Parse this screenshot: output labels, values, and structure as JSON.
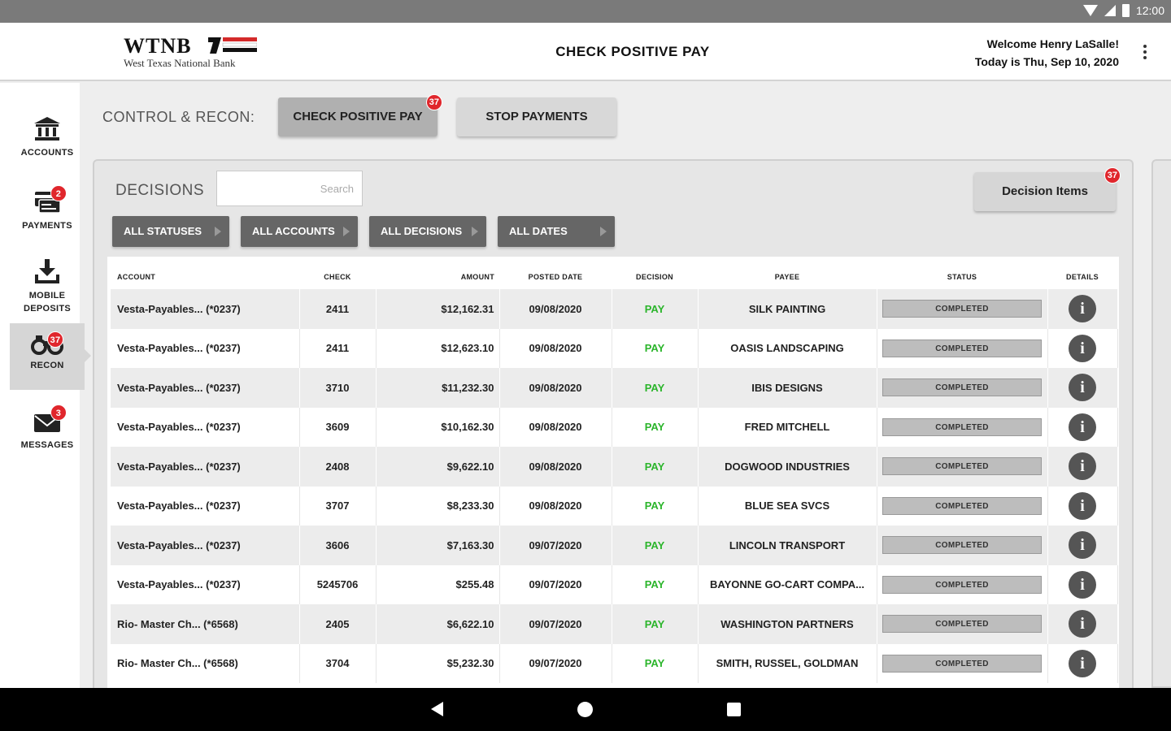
{
  "status_bar": {
    "time": "12:00"
  },
  "header": {
    "logo_text": "WTNB",
    "logo_sub": "West Texas National Bank",
    "title": "CHECK POSITIVE PAY",
    "welcome": "Welcome Henry LaSalle!",
    "date": "Today is Thu, Sep 10, 2020"
  },
  "sidebar": {
    "items": [
      {
        "label": "ACCOUNTS",
        "icon": "bank-icon",
        "badge": ""
      },
      {
        "label": "PAYMENTS",
        "icon": "payments-icon",
        "badge": "2"
      },
      {
        "label": "MOBILE",
        "label2": "DEPOSITS",
        "icon": "download-icon",
        "badge": ""
      },
      {
        "label": "RECON",
        "icon": "binoculars-icon",
        "badge": "37"
      },
      {
        "label": "MESSAGES",
        "icon": "envelope-icon",
        "badge": "3"
      }
    ]
  },
  "control_bar": {
    "label": "CONTROL & RECON:",
    "tabs": [
      {
        "label": "CHECK POSITIVE PAY",
        "badge": "37"
      },
      {
        "label": "STOP PAYMENTS"
      }
    ]
  },
  "decisions": {
    "label": "DECISIONS",
    "search_placeholder": "Search",
    "decision_items_label": "Decision Items",
    "decision_items_badge": "37",
    "filters": [
      "ALL STATUSES",
      "ALL ACCOUNTS",
      "ALL DECISIONS",
      "ALL DATES"
    ]
  },
  "table": {
    "headers": [
      "ACCOUNT",
      "CHECK",
      "AMOUNT",
      "POSTED DATE",
      "DECISION",
      "PAYEE",
      "STATUS",
      "DETAILS"
    ],
    "rows": [
      {
        "account": "Vesta-Payables... (*0237)",
        "check": "2411",
        "amount": "$12,162.31",
        "posted": "09/08/2020",
        "decision": "PAY",
        "payee": "SILK PAINTING",
        "status": "COMPLETED"
      },
      {
        "account": "Vesta-Payables... (*0237)",
        "check": "2411",
        "amount": "$12,623.10",
        "posted": "09/08/2020",
        "decision": "PAY",
        "payee": "OASIS LANDSCAPING",
        "status": "COMPLETED"
      },
      {
        "account": "Vesta-Payables... (*0237)",
        "check": "3710",
        "amount": "$11,232.30",
        "posted": "09/08/2020",
        "decision": "PAY",
        "payee": "IBIS DESIGNS",
        "status": "COMPLETED"
      },
      {
        "account": "Vesta-Payables... (*0237)",
        "check": "3609",
        "amount": "$10,162.30",
        "posted": "09/08/2020",
        "decision": "PAY",
        "payee": "FRED MITCHELL",
        "status": "COMPLETED"
      },
      {
        "account": "Vesta-Payables... (*0237)",
        "check": "2408",
        "amount": "$9,622.10",
        "posted": "09/08/2020",
        "decision": "PAY",
        "payee": "DOGWOOD INDUSTRIES",
        "status": "COMPLETED"
      },
      {
        "account": "Vesta-Payables... (*0237)",
        "check": "3707",
        "amount": "$8,233.30",
        "posted": "09/08/2020",
        "decision": "PAY",
        "payee": "BLUE SEA SVCS",
        "status": "COMPLETED"
      },
      {
        "account": "Vesta-Payables... (*0237)",
        "check": "3606",
        "amount": "$7,163.30",
        "posted": "09/07/2020",
        "decision": "PAY",
        "payee": "LINCOLN TRANSPORT",
        "status": "COMPLETED"
      },
      {
        "account": "Vesta-Payables... (*0237)",
        "check": "5245706",
        "amount": "$255.48",
        "posted": "09/07/2020",
        "decision": "PAY",
        "payee": "BAYONNE GO-CART COMPA...",
        "status": "COMPLETED"
      },
      {
        "account": "Rio- Master Ch... (*6568)",
        "check": "2405",
        "amount": "$6,622.10",
        "posted": "09/07/2020",
        "decision": "PAY",
        "payee": "WASHINGTON PARTNERS",
        "status": "COMPLETED"
      },
      {
        "account": "Rio- Master Ch... (*6568)",
        "check": "3704",
        "amount": "$5,232.30",
        "posted": "09/07/2020",
        "decision": "PAY",
        "payee": "SMITH, RUSSEL, GOLDMAN",
        "status": "COMPLETED"
      }
    ]
  },
  "colors": {
    "accent_red": "#e0262c",
    "pay_green": "#2bb52b"
  }
}
